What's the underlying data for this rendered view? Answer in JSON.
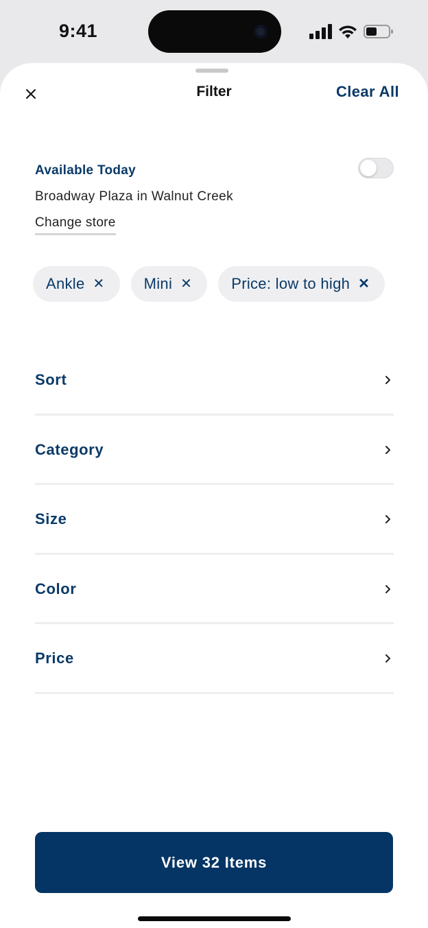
{
  "status_bar": {
    "time": "9:41"
  },
  "header": {
    "title": "Filter",
    "clear_all_label": "Clear All"
  },
  "availability": {
    "title": "Available Today",
    "store_name": "Broadway Plaza in Walnut Creek",
    "change_store_label": "Change store",
    "toggle_on": false
  },
  "chips": [
    {
      "label": "Ankle"
    },
    {
      "label": "Mini"
    },
    {
      "label": "Price: low to high"
    }
  ],
  "filter_rows": [
    {
      "label": "Sort"
    },
    {
      "label": "Category"
    },
    {
      "label": "Size"
    },
    {
      "label": "Color"
    },
    {
      "label": "Price"
    }
  ],
  "cta": {
    "label": "View 32 Items"
  },
  "colors": {
    "brand_navy": "#0a3a68",
    "button_navy": "#053565",
    "chip_bg": "#efeff1"
  },
  "icons": {
    "close": "close-icon",
    "chip_remove": "x-icon",
    "row_chevron": "chevron-right-icon"
  }
}
